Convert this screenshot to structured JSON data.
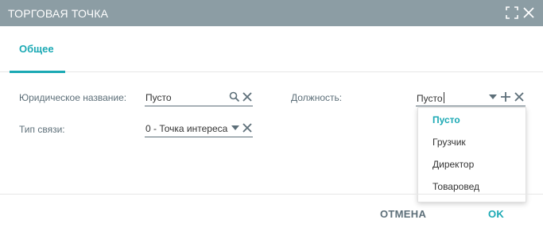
{
  "window": {
    "title": "ТОРГОВАЯ ТОЧКА",
    "icons": {
      "maximize": "expand-corners-icon",
      "close": "close-icon"
    }
  },
  "tabs": [
    {
      "label": "Общее",
      "active": true
    }
  ],
  "form": {
    "legal_name": {
      "label": "Юридическое название:",
      "value": "Пусто",
      "icons": [
        "search-icon",
        "clear-icon"
      ]
    },
    "link_type": {
      "label": "Тип связи:",
      "value": "0 - Точка интереса",
      "icons": [
        "dropdown-arrow-icon",
        "clear-icon"
      ]
    },
    "position": {
      "label": "Должность:",
      "value": "Пусто",
      "icons": [
        "dropdown-arrow-icon",
        "add-icon",
        "clear-icon"
      ]
    }
  },
  "position_dropdown": {
    "options": [
      "Пусто",
      "Грузчик",
      "Директор",
      "Товаровед"
    ],
    "selected_index": 0
  },
  "footer": {
    "cancel_label": "ОТМЕНА",
    "ok_label": "OK"
  },
  "colors": {
    "titlebar": "#8c9da4",
    "accent": "#1ba9b4",
    "label": "#5d6f79"
  }
}
